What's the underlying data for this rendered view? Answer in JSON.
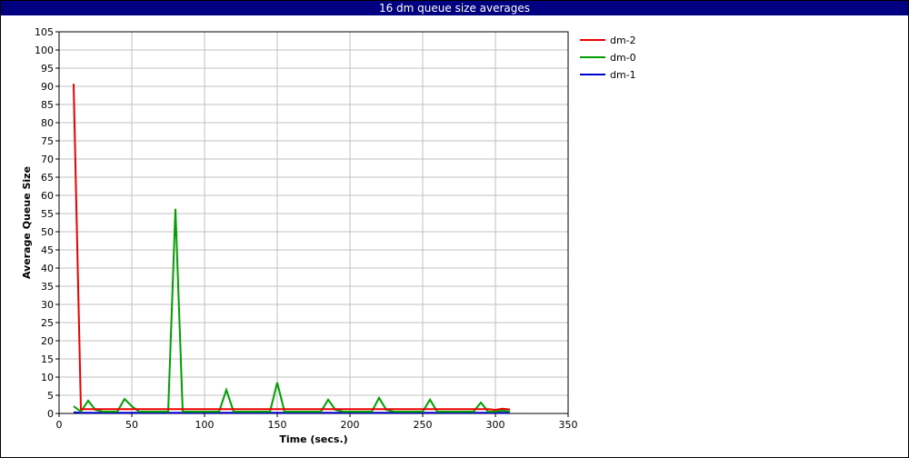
{
  "window": {
    "title": "16 dm queue size averages"
  },
  "chart_data": {
    "type": "line",
    "title": "16 dm queue size averages",
    "xlabel": "Time (secs.)",
    "ylabel": "Average Queue Size",
    "xlim": [
      0,
      350
    ],
    "ylim": [
      0,
      105
    ],
    "xticks": [
      0,
      50,
      100,
      150,
      200,
      250,
      300,
      350
    ],
    "yticks": [
      0,
      5,
      10,
      15,
      20,
      25,
      30,
      35,
      40,
      45,
      50,
      55,
      60,
      65,
      70,
      75,
      80,
      85,
      90,
      95,
      100,
      105
    ],
    "grid": true,
    "legend_position": "top-right",
    "series": [
      {
        "name": "dm-2",
        "color": "#ee0000",
        "x": [
          10,
          15,
          20,
          25,
          30,
          35,
          40,
          45,
          50,
          55,
          60,
          65,
          70,
          75,
          80,
          85,
          90,
          95,
          100,
          105,
          110,
          115,
          120,
          125,
          130,
          135,
          140,
          145,
          150,
          155,
          160,
          165,
          170,
          175,
          180,
          185,
          190,
          195,
          200,
          205,
          210,
          215,
          220,
          225,
          230,
          235,
          240,
          245,
          250,
          255,
          260,
          265,
          270,
          275,
          280,
          285,
          290,
          295,
          300,
          305,
          310
        ],
        "y": [
          90.7,
          1.2,
          1.2,
          1.2,
          1.2,
          1.2,
          1.2,
          1.2,
          1.2,
          1.2,
          1.2,
          1.2,
          1.2,
          1.2,
          1.2,
          1.2,
          1.2,
          1.2,
          1.2,
          1.2,
          1.2,
          1.2,
          1.2,
          1.2,
          1.2,
          1.2,
          1.2,
          1.2,
          1.2,
          1.2,
          1.2,
          1.2,
          1.2,
          1.2,
          1.2,
          1.2,
          1.2,
          1.2,
          1.2,
          1.2,
          1.2,
          1.2,
          1.2,
          1.2,
          1.2,
          1.2,
          1.2,
          1.2,
          1.2,
          1.2,
          1.2,
          1.2,
          1.2,
          1.2,
          1.2,
          1.2,
          1.2,
          1.2,
          1.0,
          1.3,
          1.1
        ]
      },
      {
        "name": "dm-0",
        "color": "#00a000",
        "x": [
          10,
          15,
          20,
          25,
          30,
          35,
          40,
          45,
          50,
          55,
          60,
          65,
          70,
          75,
          80,
          85,
          90,
          95,
          100,
          105,
          110,
          115,
          120,
          125,
          130,
          135,
          140,
          145,
          150,
          155,
          160,
          165,
          170,
          175,
          180,
          185,
          190,
          195,
          200,
          205,
          210,
          215,
          220,
          225,
          230,
          235,
          240,
          245,
          250,
          255,
          260,
          265,
          270,
          275,
          280,
          285,
          290,
          295,
          300,
          305,
          310
        ],
        "y": [
          2.0,
          0.5,
          3.5,
          1.0,
          0.5,
          0.5,
          0.5,
          4.0,
          2.0,
          0.5,
          0.5,
          0.5,
          0.5,
          0.5,
          56.3,
          0.5,
          0.5,
          0.5,
          0.5,
          0.5,
          0.5,
          6.5,
          0.5,
          0.5,
          0.5,
          0.5,
          0.5,
          0.5,
          8.5,
          0.5,
          0.5,
          0.5,
          0.5,
          0.5,
          0.5,
          3.8,
          1.0,
          0.5,
          0.5,
          0.5,
          0.5,
          0.5,
          4.3,
          1.0,
          0.5,
          0.5,
          0.5,
          0.5,
          0.5,
          3.8,
          0.5,
          0.5,
          0.5,
          0.5,
          0.5,
          0.5,
          3.0,
          0.5,
          0.5,
          0.8,
          0.5
        ]
      },
      {
        "name": "dm-1",
        "color": "#0000cc",
        "x": [
          10,
          15,
          20,
          50,
          100,
          150,
          200,
          250,
          300,
          310
        ],
        "y": [
          0.3,
          0.2,
          0.2,
          0.2,
          0.2,
          0.2,
          0.2,
          0.2,
          0.2,
          0.2
        ]
      }
    ]
  }
}
